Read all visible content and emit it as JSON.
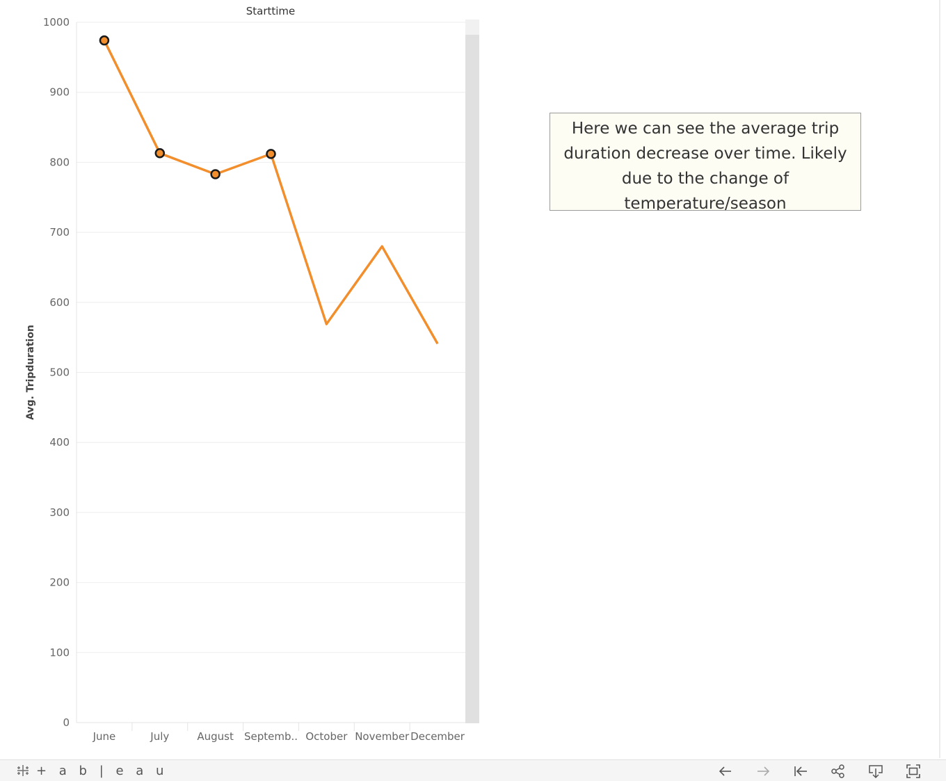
{
  "header": {
    "title": "Starttime"
  },
  "annotation": {
    "text": "Here we can see the average trip duration decrease over time. Likely due to the change of temperature/season"
  },
  "colors": {
    "line": "#f28e2b",
    "marker_border": "#1a1a1a",
    "grid": "#eeeeee",
    "scrollbar": "#e0e0e0"
  },
  "chart_data": {
    "type": "line",
    "title": "Starttime",
    "xlabel": "",
    "ylabel": "Avg. Tripduration",
    "categories": [
      "June",
      "July",
      "August",
      "Septemb..",
      "October",
      "November",
      "December"
    ],
    "series": [
      {
        "values": [
          974,
          813,
          783,
          812,
          569,
          680,
          541
        ]
      }
    ],
    "highlighted_points": [
      "June",
      "July",
      "August",
      "Septemb.."
    ],
    "ylim": [
      0,
      1000
    ],
    "yticks": [
      0,
      100,
      200,
      300,
      400,
      500,
      600,
      700,
      800,
      900,
      1000
    ],
    "grid": true,
    "legend": "none"
  },
  "footer": {
    "brand": "+ a b | e a u",
    "buttons": [
      {
        "name": "undo-button",
        "icon": "arrow-left-icon"
      },
      {
        "name": "redo-button",
        "icon": "arrow-right-icon"
      },
      {
        "name": "revert-button",
        "icon": "revert-icon"
      },
      {
        "name": "share-button",
        "icon": "share-icon"
      },
      {
        "name": "download-button",
        "icon": "download-icon"
      },
      {
        "name": "fullscreen-button",
        "icon": "fullscreen-icon"
      }
    ]
  }
}
